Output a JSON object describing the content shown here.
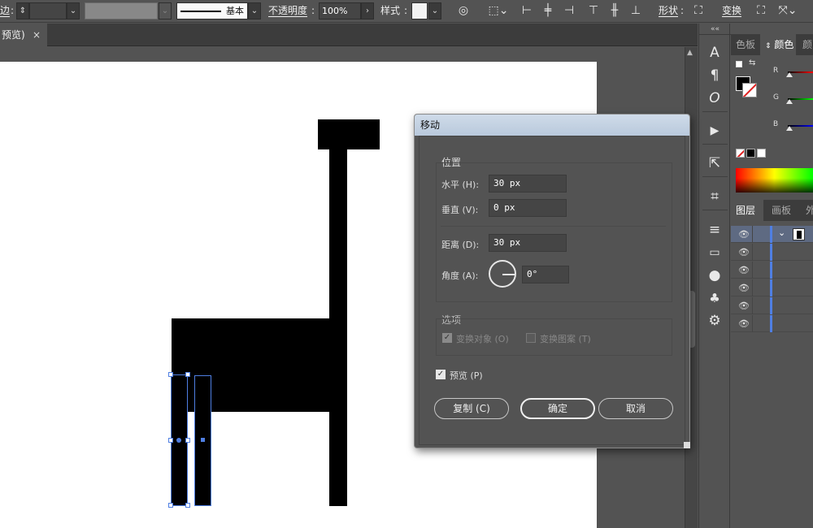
{
  "control_bar": {
    "stroke_label": "边",
    "stroke_preset": "基本",
    "opacity_label": "不透明度",
    "opacity_value": "100%",
    "style_label": "样式",
    "shape_label": "形状",
    "transform_label": "变换"
  },
  "doc_tab": {
    "label": "预览)",
    "close": "×"
  },
  "tools_panel": {
    "collapse": "««",
    "icons": [
      "character-icon",
      "paragraph-icon",
      "opentype-icon",
      "actions-icon",
      "export-icon",
      "artboard-icon",
      "align-icon",
      "gradient-icon",
      "appearance-icon",
      "symbols-icon",
      "settings-icon"
    ]
  },
  "color_panel": {
    "tabs": [
      "色板",
      "颜色",
      "颜"
    ],
    "channels": [
      "R",
      "G",
      "B"
    ]
  },
  "layers_panel": {
    "tabs": [
      "图层",
      "画板",
      "外"
    ],
    "rows": 6
  },
  "move_dialog": {
    "title": "移动",
    "position_group": "位置",
    "horizontal_label": "水平 (H):",
    "horizontal_value": "30 px",
    "vertical_label": "垂直 (V):",
    "vertical_value": "0 px",
    "distance_label": "距离 (D):",
    "distance_value": "30 px",
    "angle_label": "角度 (A):",
    "angle_value": "0°",
    "options_group": "选项",
    "transform_objects_label": "变换对象 (O)",
    "transform_objects_checked": true,
    "transform_patterns_label": "变换图案 (T)",
    "transform_patterns_checked": false,
    "preview_label": "预览 (P)",
    "preview_checked": true,
    "copy_button": "复制 (C)",
    "ok_button": "确定",
    "cancel_button": "取消"
  }
}
